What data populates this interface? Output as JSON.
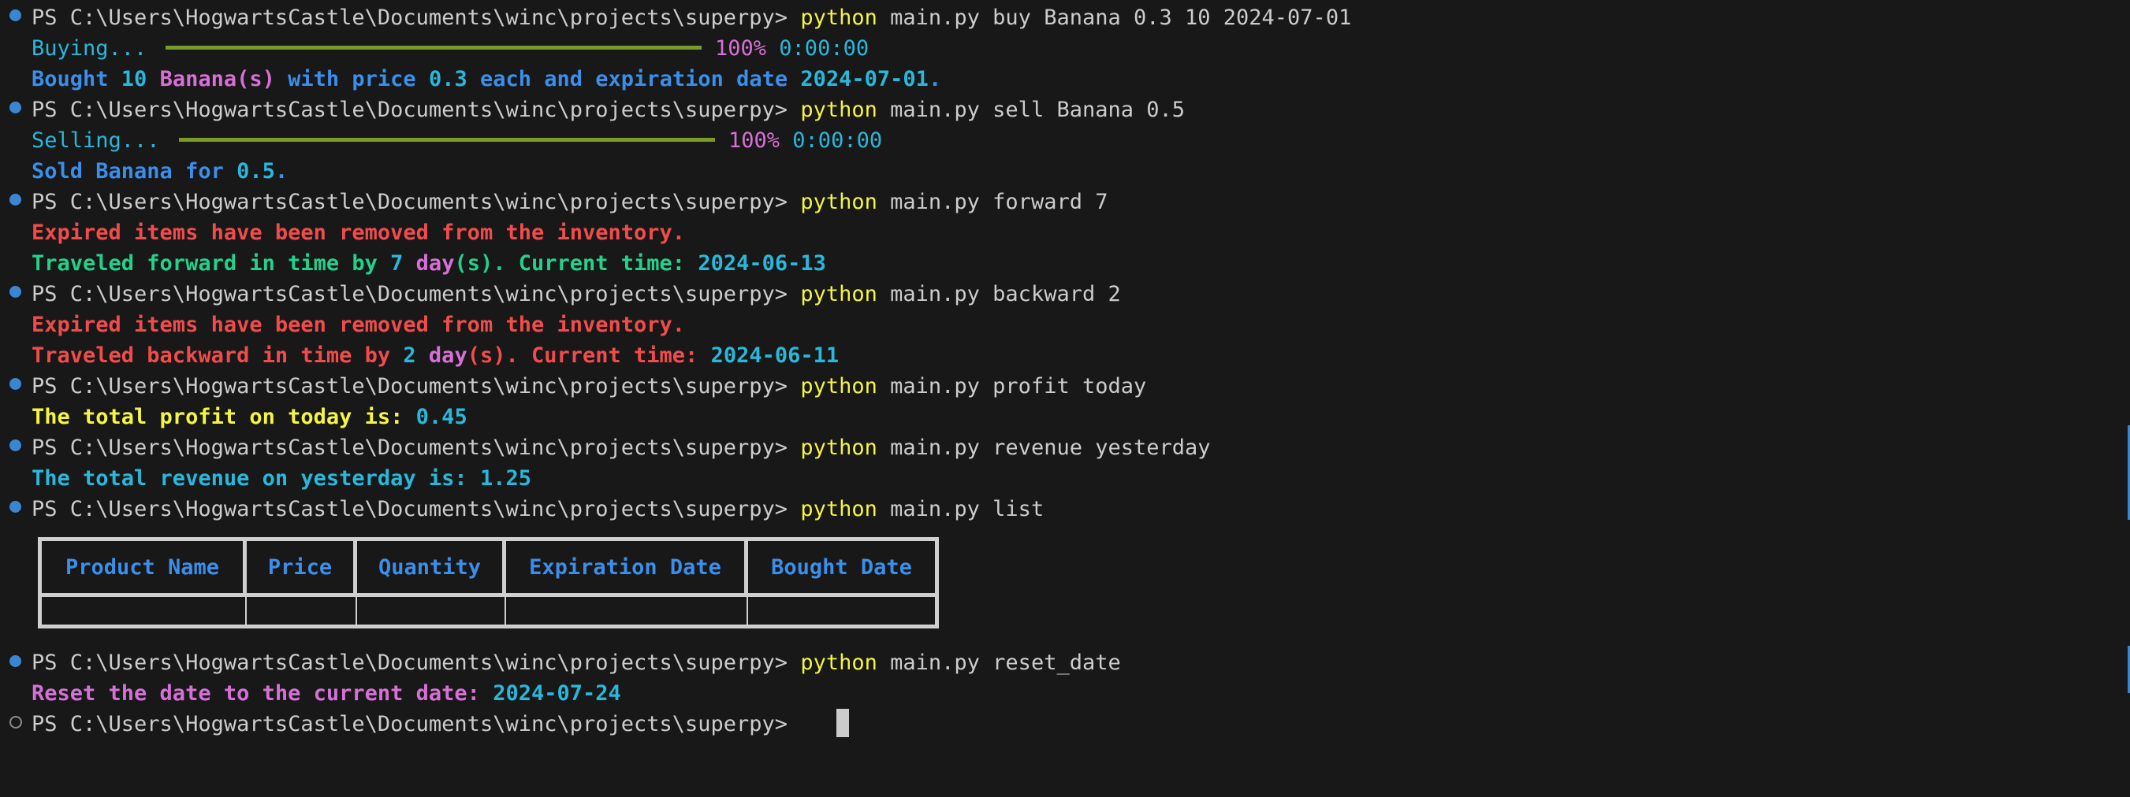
{
  "prompt": "PS C:\\Users\\HogwartsCastle\\Documents\\winc\\projects\\superpy> ",
  "commands": {
    "buy": {
      "python": "python",
      "args": " main.py buy Banana 0.3 10 2024-07-01"
    },
    "sell": {
      "python": "python",
      "args": " main.py sell Banana 0.5"
    },
    "forward": {
      "python": "python",
      "args": " main.py forward 7"
    },
    "backward": {
      "python": "python",
      "args": " main.py backward 2"
    },
    "profit": {
      "python": "python",
      "args": " main.py profit today"
    },
    "revenue": {
      "python": "python",
      "args": " main.py revenue yesterday"
    },
    "list": {
      "python": "python",
      "args": " main.py list"
    },
    "reset": {
      "python": "python",
      "args": " main.py reset_date"
    }
  },
  "buy_output": {
    "progress_label": "Buying...",
    "progress_percent": "100%",
    "progress_time": "0:00:00",
    "progress_fraction": 1.0,
    "msg_prefix": "Bought ",
    "msg_qty": "10",
    "msg_product": " Banana(s)",
    "msg_mid": " with price ",
    "msg_price": "0.3",
    "msg_mid2": " each and expiration date ",
    "msg_date": "2024-07-01",
    "msg_end": "."
  },
  "sell_output": {
    "progress_label": "Selling...",
    "progress_percent": "100%",
    "progress_time": "0:00:00",
    "progress_fraction": 1.0,
    "msg_prefix": "Sold Banana for ",
    "msg_price": "0.5",
    "msg_end": "."
  },
  "forward_output": {
    "expired": "Expired items have been removed from the inventory.",
    "msg_prefix": "Traveled forward in time by ",
    "msg_days": "7",
    "msg_unit": " day",
    "msg_unit_end": "(s). Current time: ",
    "msg_date": "2024-06-13"
  },
  "backward_output": {
    "expired": "Expired items have been removed from the inventory.",
    "msg_prefix": "Traveled backward in time by ",
    "msg_days": "2",
    "msg_unit": " day",
    "msg_unit_end": "(s). Current time: ",
    "msg_date": "2024-06-11"
  },
  "profit_output": {
    "label": "The total profit on today is: ",
    "value": "0.45"
  },
  "revenue_output": {
    "label": "The total revenue on yesterday is: ",
    "value": "1.25"
  },
  "inventory_table": {
    "headers": [
      "Product Name",
      "Price",
      "Quantity",
      "Expiration Date",
      "Bought Date"
    ]
  },
  "reset_output": {
    "label": "Reset the date to the current date: ",
    "date": "2024-07-24"
  },
  "colors": {
    "background": "#181818",
    "command_dot": "#3a86d0",
    "python": "#f5f543",
    "blue": "#3b8eea",
    "cyan": "#29b8db",
    "magenta": "#d670d6",
    "red": "#f14c4c",
    "green": "#23d18b",
    "progress_bar": "#7a9a2a"
  }
}
